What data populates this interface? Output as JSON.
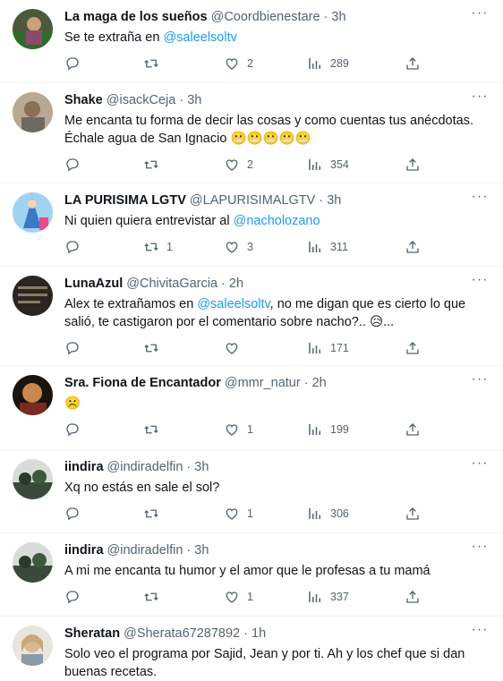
{
  "tweets": [
    {
      "name": "La maga de los sueños",
      "handle": "@Coordbienestare",
      "time": "3h",
      "text_plain": "Se te extraña en ",
      "mention1": "@saleelsoltv",
      "text_after": "",
      "text_line2": "",
      "emojis": "",
      "replies": "",
      "retweets": "",
      "likes": "2",
      "views": "289"
    },
    {
      "name": "Shake",
      "handle": "@isackCeja",
      "time": "3h",
      "text_plain": "Me encanta tu forma de decir las cosas y como cuentas tus anécdotas.",
      "mention1": "",
      "text_after": "",
      "text_line2": "Échale agua de San Ignacio",
      "emojis": "😬😬😬😬😬",
      "replies": "",
      "retweets": "",
      "likes": "2",
      "views": "354"
    },
    {
      "name": "LA PURISIMA LGTV",
      "handle": "@LAPURISIMALGTV",
      "time": "3h",
      "text_plain": "Ni quien quiera entrevistar al ",
      "mention1": "@nacholozano",
      "text_after": "",
      "text_line2": "",
      "emojis": "",
      "replies": "",
      "retweets": "1",
      "likes": "3",
      "views": "311"
    },
    {
      "name": "LunaAzul",
      "handle": "@ChivitaGarcia",
      "time": "2h",
      "text_plain": "Alex te extrañamos en ",
      "mention1": "@saleelsoltv",
      "text_after": ",  no me digan que es cierto lo que",
      "text_line2": "salió, te castigaron por el comentario sobre nacho?..",
      "emojis": "😥",
      "text_tail": "...",
      "replies": "",
      "retweets": "",
      "likes": "",
      "views": "171"
    },
    {
      "name": "Sra. Fiona de Encantador",
      "handle": "@mmr_natur",
      "time": "2h",
      "text_plain": "",
      "mention1": "",
      "text_after": "",
      "text_line2": "",
      "emojis": "☹️",
      "replies": "",
      "retweets": "",
      "likes": "1",
      "views": "199"
    },
    {
      "name": "iindira",
      "handle": "@indiradelfin",
      "time": "3h",
      "text_plain": "Xq no estás en sale el sol?",
      "mention1": "",
      "text_after": "",
      "text_line2": "",
      "emojis": "",
      "replies": "",
      "retweets": "",
      "likes": "1",
      "views": "306"
    },
    {
      "name": "iindira",
      "handle": "@indiradelfin",
      "time": "3h",
      "text_plain": "A mi me encanta tu humor y el amor que le profesas a tu mamá",
      "mention1": "",
      "text_after": "",
      "text_line2": "",
      "emojis": "",
      "replies": "",
      "retweets": "",
      "likes": "1",
      "views": "337"
    },
    {
      "name": "Sheratan",
      "handle": "@Sherata67287892",
      "time": "1h",
      "text_plain": "Solo veo el programa por Sajid, Jean y por ti. Ah y los chef que si dan",
      "mention1": "",
      "text_after": "",
      "text_line2": "buenas recetas.",
      "emojis": "",
      "replies": "",
      "retweets": "",
      "likes": "",
      "views": ""
    }
  ],
  "colors": {
    "mention": "#1d9bf0",
    "secondary_text": "#536471",
    "divider": "#eff3f4"
  },
  "icons": [
    "reply-icon",
    "retweet-icon",
    "like-icon",
    "views-icon",
    "share-icon",
    "more-icon"
  ]
}
